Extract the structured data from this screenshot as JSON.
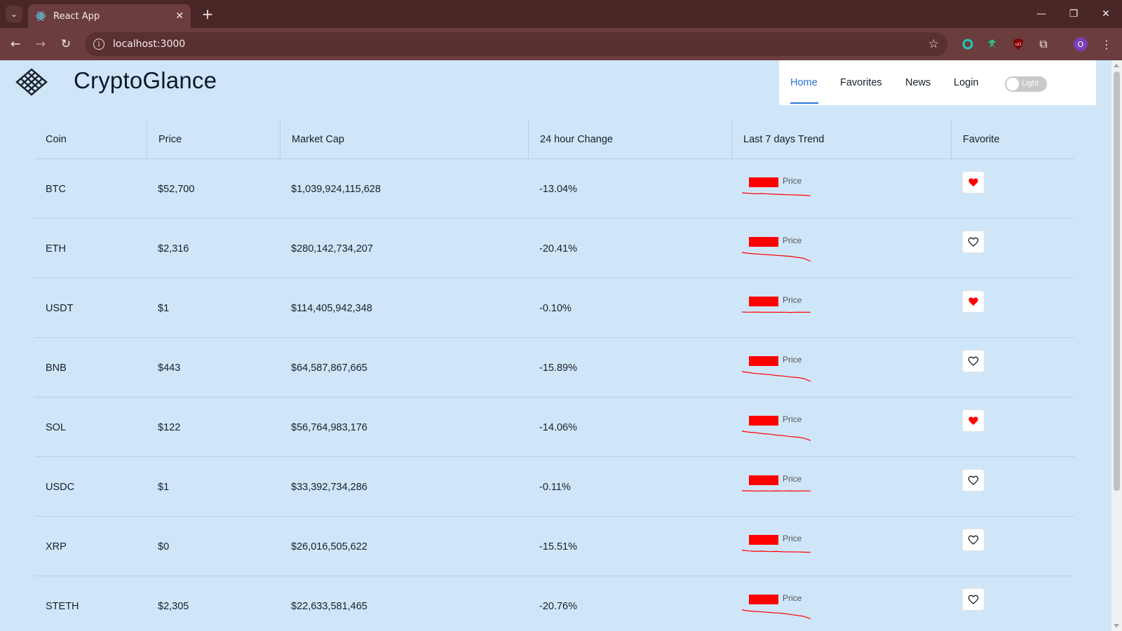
{
  "browser": {
    "tab_title": "React App",
    "url": "localhost:3000",
    "profile_initial": "O"
  },
  "header": {
    "brand": "CryptoGlance",
    "nav": [
      {
        "label": "Home",
        "active": true
      },
      {
        "label": "Favorites",
        "active": false
      },
      {
        "label": "News",
        "active": false
      },
      {
        "label": "Login",
        "active": false
      }
    ],
    "theme_toggle_label": "Light"
  },
  "table": {
    "columns": [
      "Coin",
      "Price",
      "Market Cap",
      "24 hour Change",
      "Last 7 days Trend",
      "Favorite"
    ],
    "legend_label": "Price",
    "rows": [
      {
        "coin": "BTC",
        "price": "$52,700",
        "market_cap": "$1,039,924,115,628",
        "change": "-13.04%",
        "favorite": true
      },
      {
        "coin": "ETH",
        "price": "$2,316",
        "market_cap": "$280,142,734,207",
        "change": "-20.41%",
        "favorite": false
      },
      {
        "coin": "USDT",
        "price": "$1",
        "market_cap": "$114,405,942,348",
        "change": "-0.10%",
        "favorite": true
      },
      {
        "coin": "BNB",
        "price": "$443",
        "market_cap": "$64,587,867,665",
        "change": "-15.89%",
        "favorite": false
      },
      {
        "coin": "SOL",
        "price": "$122",
        "market_cap": "$56,764,983,176",
        "change": "-14.06%",
        "favorite": true
      },
      {
        "coin": "USDC",
        "price": "$1",
        "market_cap": "$33,392,734,286",
        "change": "-0.11%",
        "favorite": false
      },
      {
        "coin": "XRP",
        "price": "$0",
        "market_cap": "$26,016,505,622",
        "change": "-15.51%",
        "favorite": false
      },
      {
        "coin": "STETH",
        "price": "$2,305",
        "market_cap": "$22,633,581,465",
        "change": "-20.76%",
        "favorite": false
      }
    ]
  },
  "colors": {
    "page_bg": "#cfe6f8",
    "accent": "#2b73d6",
    "trend_line": "#ff0000",
    "favorite_heart": "#ff0000"
  }
}
